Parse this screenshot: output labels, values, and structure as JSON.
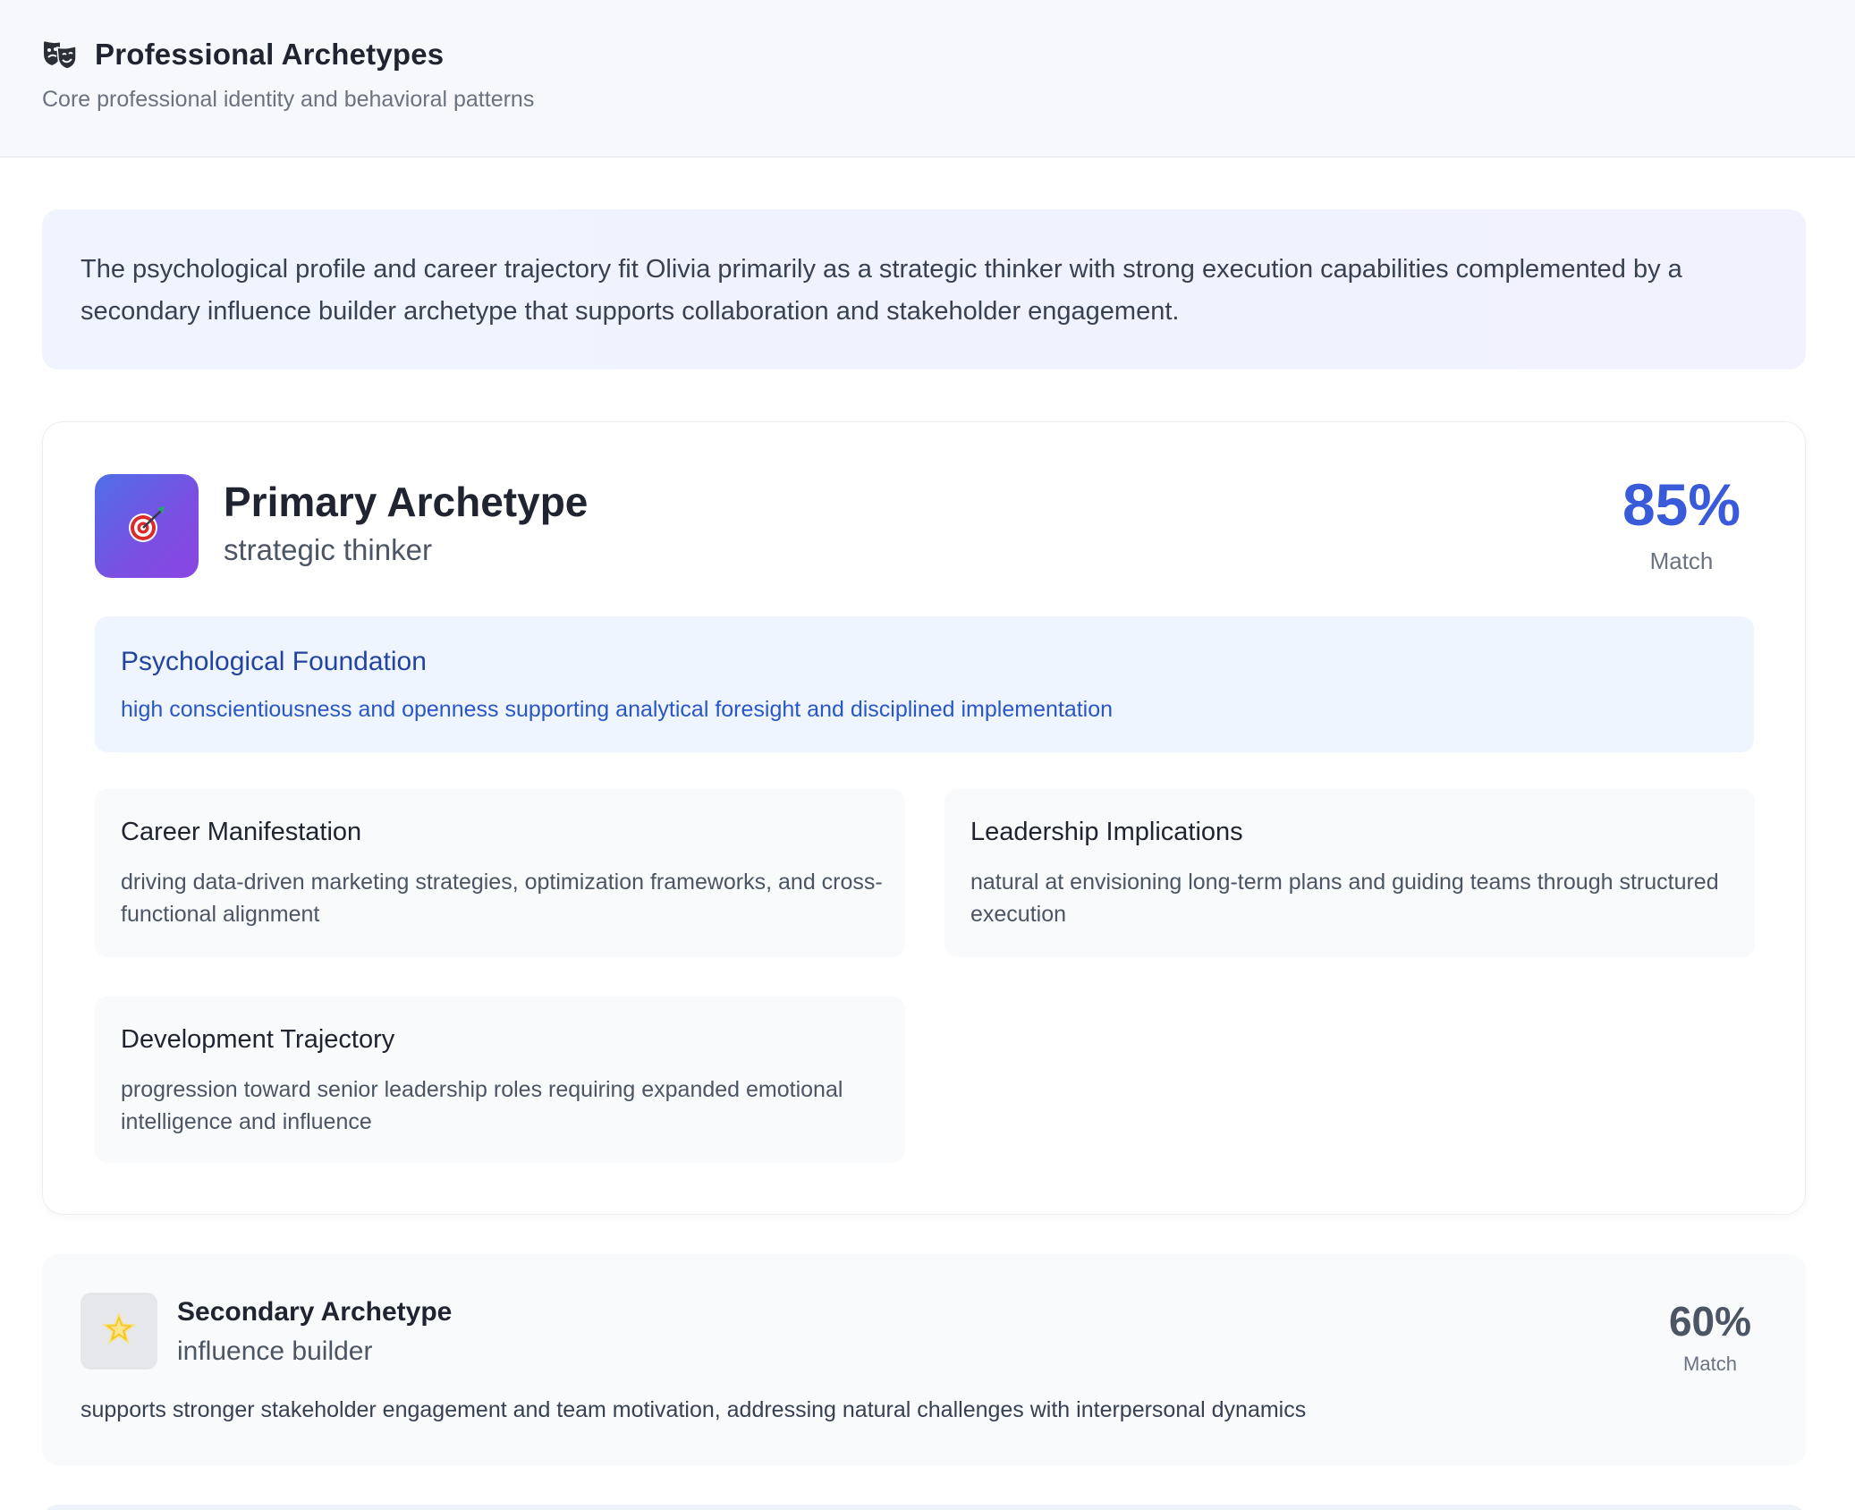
{
  "header": {
    "icon": "performing-arts-masks-icon",
    "title": "Professional Archetypes",
    "subtitle": "Core professional identity and behavioral patterns"
  },
  "summary": {
    "text": "The psychological profile and career trajectory fit Olivia primarily as a strategic thinker with strong execution capabilities complemented by a secondary influence builder archetype that supports collaboration and stakeholder engagement."
  },
  "primary": {
    "icon": "dart-target-icon",
    "heading": "Primary Archetype",
    "name": "strategic thinker",
    "match_value": "85%",
    "match_label": "Match",
    "foundation": {
      "title": "Psychological Foundation",
      "text": "high conscientiousness and openness supporting analytical foresight and disciplined implementation"
    },
    "career": {
      "title": "Career Manifestation",
      "text": "driving data-driven marketing strategies, optimization frameworks, and cross-functional alignment"
    },
    "leadership": {
      "title": "Leadership Implications",
      "text": "natural at envisioning long-term plans and guiding teams through structured execution"
    },
    "development": {
      "title": "Development Trajectory",
      "text": "progression toward senior leadership roles requiring expanded emotional intelligence and influence"
    }
  },
  "secondary": {
    "icon": "glowing-star-icon",
    "heading": "Secondary Archetype",
    "name": "influence builder",
    "match_value": "60%",
    "match_label": "Match",
    "text": "supports stronger stakeholder engagement and team motivation, addressing natural challenges with interpersonal dynamics"
  },
  "colors": {
    "accent_blue": "#3a5bd9",
    "foundation_bg": "#eff5ff",
    "icon_gradient_start": "#4f6fe8",
    "icon_gradient_end": "#8a45e3"
  }
}
